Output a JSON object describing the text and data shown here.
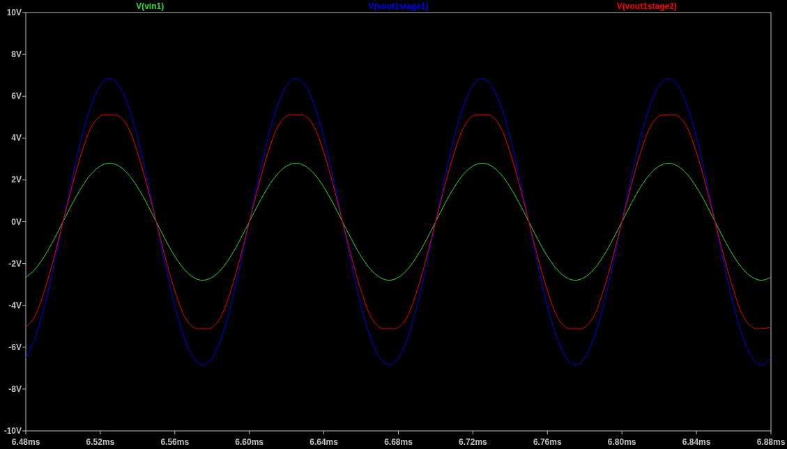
{
  "chart_data": {
    "type": "line",
    "xlim": [
      6.48,
      6.88
    ],
    "ylim": [
      -10,
      10
    ],
    "xticks": [
      {
        "value": 6.48,
        "label": "6.48ms"
      },
      {
        "value": 6.52,
        "label": "6.52ms"
      },
      {
        "value": 6.56,
        "label": "6.56ms"
      },
      {
        "value": 6.6,
        "label": "6.60ms"
      },
      {
        "value": 6.64,
        "label": "6.64ms"
      },
      {
        "value": 6.68,
        "label": "6.68ms"
      },
      {
        "value": 6.72,
        "label": "6.72ms"
      },
      {
        "value": 6.76,
        "label": "6.76ms"
      },
      {
        "value": 6.8,
        "label": "6.80ms"
      },
      {
        "value": 6.84,
        "label": "6.84ms"
      },
      {
        "value": 6.88,
        "label": "6.88ms"
      }
    ],
    "yticks": [
      {
        "value": 10,
        "label": "10V"
      },
      {
        "value": 8,
        "label": "8V"
      },
      {
        "value": 6,
        "label": "6V"
      },
      {
        "value": 4,
        "label": "4V"
      },
      {
        "value": 2,
        "label": "2V"
      },
      {
        "value": 0,
        "label": "0V"
      },
      {
        "value": -2,
        "label": "-2V"
      },
      {
        "value": -4,
        "label": "-4V"
      },
      {
        "value": -6,
        "label": "-6V"
      },
      {
        "value": -8,
        "label": "-8V"
      },
      {
        "value": -10,
        "label": "-10V"
      }
    ],
    "x": [
      6.48,
      6.485,
      6.49,
      6.495,
      6.5,
      6.505,
      6.51,
      6.515,
      6.52,
      6.525,
      6.53,
      6.535,
      6.54,
      6.545,
      6.55,
      6.555,
      6.56,
      6.565,
      6.57,
      6.575,
      6.58,
      6.585,
      6.59,
      6.595,
      6.6,
      6.605,
      6.61,
      6.615,
      6.62,
      6.625,
      6.63,
      6.635,
      6.64,
      6.645,
      6.65,
      6.655,
      6.66,
      6.665,
      6.67,
      6.675,
      6.68,
      6.685,
      6.69,
      6.695,
      6.7,
      6.705,
      6.71,
      6.715,
      6.72,
      6.725,
      6.73,
      6.735,
      6.74,
      6.745,
      6.75,
      6.755,
      6.76,
      6.765,
      6.77,
      6.775,
      6.78,
      6.785,
      6.79,
      6.795,
      6.8,
      6.805,
      6.81,
      6.815,
      6.82,
      6.825,
      6.83,
      6.835,
      6.84,
      6.845,
      6.85,
      6.855,
      6.86,
      6.865,
      6.87,
      6.875,
      6.88
    ],
    "series": [
      {
        "name": "V(vin1)",
        "color": "#33dd33",
        "values": [
          -2.66,
          -2.27,
          -1.65,
          -0.87,
          0,
          0.87,
          1.65,
          2.27,
          2.66,
          2.8,
          2.66,
          2.27,
          1.65,
          0.87,
          0,
          -0.87,
          -1.65,
          -2.27,
          -2.66,
          -2.8,
          -2.66,
          -2.27,
          -1.65,
          -0.87,
          0,
          0.87,
          1.65,
          2.27,
          2.66,
          2.8,
          2.66,
          2.27,
          1.65,
          0.87,
          0,
          -0.87,
          -1.65,
          -2.27,
          -2.66,
          -2.8,
          -2.66,
          -2.27,
          -1.65,
          -0.87,
          0,
          0.87,
          1.65,
          2.27,
          2.66,
          2.8,
          2.66,
          2.27,
          1.65,
          0.87,
          0,
          -0.87,
          -1.65,
          -2.27,
          -2.66,
          -2.8,
          -2.66,
          -2.27,
          -1.65,
          -0.87,
          0,
          0.87,
          1.65,
          2.27,
          2.66,
          2.8,
          2.66,
          2.27,
          1.65,
          0.87,
          0,
          -0.87,
          -1.65,
          -2.27,
          -2.66,
          -2.8,
          -2.66
        ]
      },
      {
        "name": "V(vout1stage1)",
        "color": "#0000ff",
        "values": [
          -6.51,
          -5.54,
          -4.03,
          -2.12,
          0,
          2.12,
          4.03,
          5.54,
          6.51,
          6.85,
          6.51,
          5.54,
          4.03,
          2.12,
          0,
          -2.12,
          -4.03,
          -5.54,
          -6.51,
          -6.85,
          -6.51,
          -5.54,
          -4.03,
          -2.12,
          0,
          2.12,
          4.03,
          5.54,
          6.51,
          6.85,
          6.51,
          5.54,
          4.03,
          2.12,
          0,
          -2.12,
          -4.03,
          -5.54,
          -6.51,
          -6.85,
          -6.51,
          -5.54,
          -4.03,
          -2.12,
          0,
          2.12,
          4.03,
          5.54,
          6.51,
          6.85,
          6.51,
          5.54,
          4.03,
          2.12,
          0,
          -2.12,
          -4.03,
          -5.54,
          -6.51,
          -6.85,
          -6.51,
          -5.54,
          -4.03,
          -2.12,
          0,
          2.12,
          4.03,
          5.54,
          6.51,
          6.85,
          6.51,
          5.54,
          4.03,
          2.12,
          0,
          -2.12,
          -4.03,
          -5.54,
          -6.51,
          -6.85,
          -6.51
        ]
      },
      {
        "name": "V(vout1stage2)",
        "color": "#ff0000",
        "values": [
          -5.05,
          -4.5,
          -3.3,
          -1.75,
          0,
          1.75,
          3.3,
          4.5,
          5.05,
          5.1,
          5.05,
          4.5,
          3.3,
          1.75,
          0,
          -1.75,
          -3.3,
          -4.5,
          -5.05,
          -5.1,
          -5.05,
          -4.5,
          -3.3,
          -1.75,
          0,
          1.75,
          3.3,
          4.5,
          5.05,
          5.1,
          5.05,
          4.5,
          3.3,
          1.75,
          0,
          -1.75,
          -3.3,
          -4.5,
          -5.05,
          -5.1,
          -5.05,
          -4.5,
          -3.3,
          -1.75,
          0,
          1.75,
          3.3,
          4.5,
          5.05,
          5.1,
          5.05,
          4.5,
          3.3,
          1.75,
          0,
          -1.75,
          -3.3,
          -4.5,
          -5.05,
          -5.1,
          -5.05,
          -4.5,
          -3.3,
          -1.75,
          0,
          1.75,
          3.3,
          4.5,
          5.05,
          5.1,
          5.05,
          4.5,
          3.3,
          1.75,
          0,
          -1.75,
          -3.3,
          -4.5,
          -5.05,
          -5.1,
          -5.05
        ]
      }
    ]
  }
}
